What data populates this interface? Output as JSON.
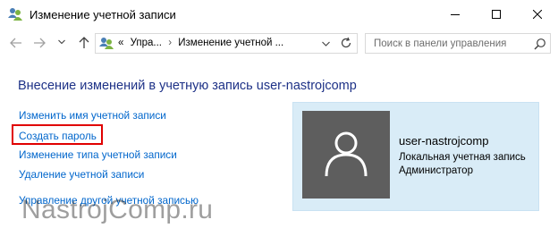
{
  "window": {
    "title": "Изменение учетной записи",
    "icon": "user-accounts-icon",
    "controls": {
      "minimize": "minimize-icon",
      "maximize": "maximize-icon",
      "close": "close-icon"
    }
  },
  "navbar": {
    "breadcrumb": {
      "overflow": "«",
      "items": [
        "Упра...",
        "Изменение учетной ..."
      ],
      "separator": "›"
    },
    "search": {
      "placeholder": "Поиск в панели управления",
      "value": ""
    }
  },
  "main": {
    "heading": "Внесение изменений в учетную запись user-nastrojcomp",
    "links": {
      "rename": "Изменить имя учетной записи",
      "create_password": "Создать пароль",
      "change_type": "Изменение типа учетной записи",
      "delete": "Удаление учетной записи",
      "manage_other": "Управление другой учетной записью"
    },
    "highlight_color": "#e00000"
  },
  "user_card": {
    "username": "user-nastrojcomp",
    "account_type": "Локальная учетная запись",
    "role": "Администратор",
    "background": "#d9ecf7",
    "avatar_bg": "#5e5e5e"
  },
  "watermark": "NastrojComp.ru",
  "colors": {
    "heading": "#1e3287",
    "link": "#0066cc"
  }
}
